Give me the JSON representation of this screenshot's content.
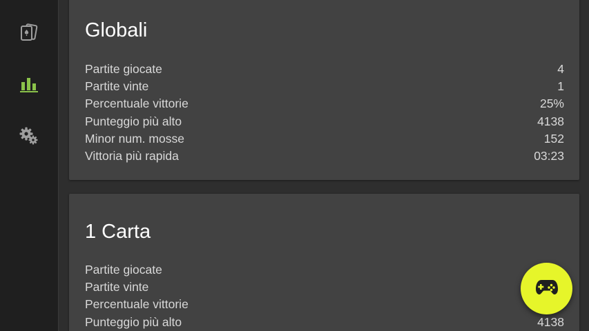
{
  "sidebar": {
    "items": [
      {
        "icon": "cards-icon",
        "active": false
      },
      {
        "icon": "bar-chart-icon",
        "active": true
      },
      {
        "icon": "gears-icon",
        "active": false
      }
    ],
    "active_color": "#8bc34a",
    "inactive_color": "#9e9e9e"
  },
  "cards": [
    {
      "title": "Globali",
      "rows": [
        {
          "label": "Partite giocate",
          "value": "4"
        },
        {
          "label": "Partite vinte",
          "value": "1"
        },
        {
          "label": "Percentuale vittorie",
          "value": "25%"
        },
        {
          "label": "Punteggio più alto",
          "value": "4138"
        },
        {
          "label": "Minor num. mosse",
          "value": "152"
        },
        {
          "label": "Vittoria più rapida",
          "value": "03:23"
        }
      ]
    },
    {
      "title": "1 Carta",
      "rows": [
        {
          "label": "Partite giocate",
          "value": ""
        },
        {
          "label": "Partite vinte",
          "value": ""
        },
        {
          "label": "Percentuale vittorie",
          "value": ""
        },
        {
          "label": "Punteggio più alto",
          "value": "4138"
        }
      ]
    }
  ],
  "fab": {
    "icon": "gamepad-icon",
    "color": "#e6f52a"
  }
}
